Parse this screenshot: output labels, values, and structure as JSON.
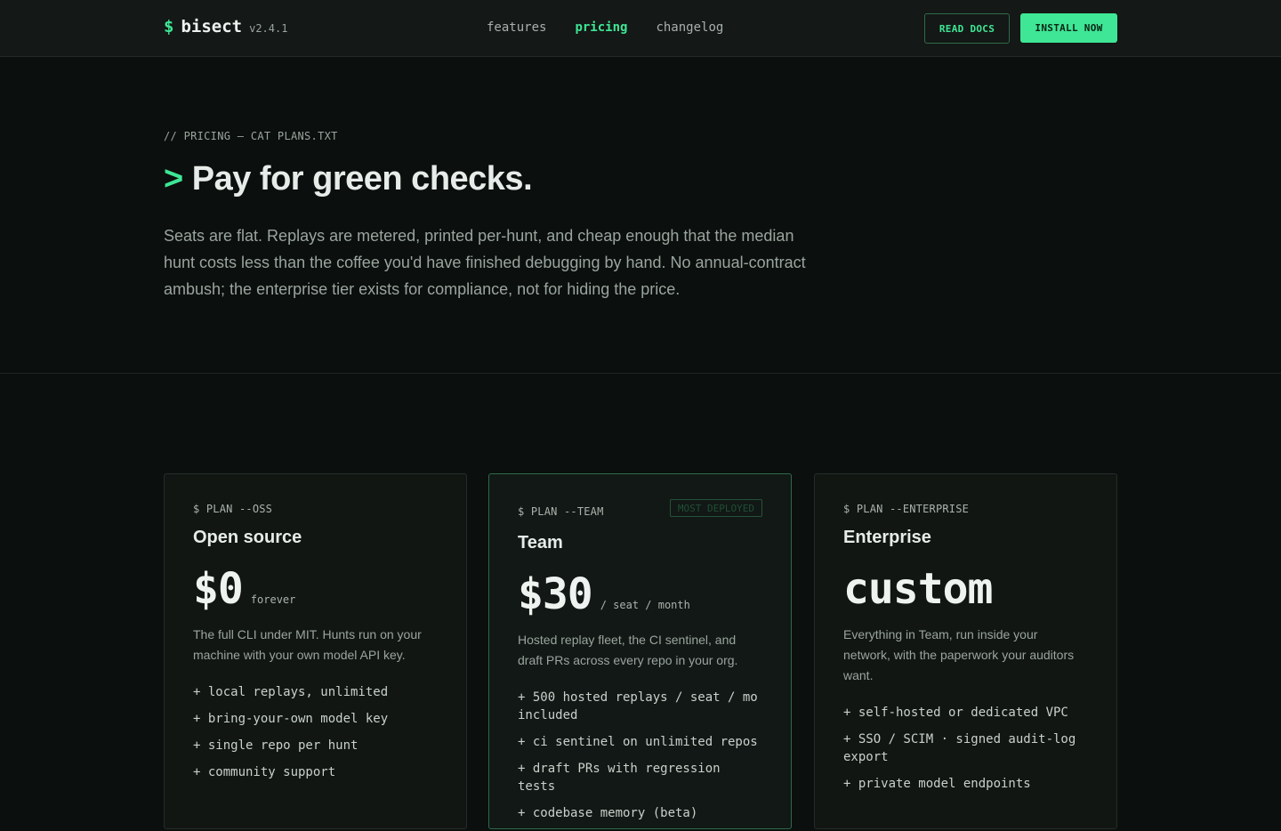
{
  "header": {
    "brand_symbol": "$",
    "brand_name": "bisect",
    "version": "v2.4.1",
    "nav": [
      {
        "label": "features",
        "active": false
      },
      {
        "label": "pricing",
        "active": true
      },
      {
        "label": "changelog",
        "active": false
      }
    ],
    "read_docs_label": "READ DOCS",
    "install_label": "INSTALL NOW"
  },
  "hero": {
    "crumb": "// PRICING — CAT PLANS.TXT",
    "prompt": ">",
    "headline": "Pay for green checks.",
    "lede": "Seats are flat. Replays are metered, printed per-hunt, and cheap enough that the median hunt costs less than the coffee you'd have finished debugging by hand. No annual-contract ambush; the enterprise tier exists for compliance, not for hiding the price."
  },
  "plans": [
    {
      "cmd": "$ PLAN --OSS",
      "name": "Open source",
      "price": "$0",
      "unit": "forever",
      "description": "The full CLI under MIT. Hunts run on your machine with your own model API key.",
      "features": [
        "+ local replays, unlimited",
        "+ bring-your-own model key",
        "+ single repo per hunt",
        "+ community support"
      ]
    },
    {
      "cmd": "$ PLAN --TEAM",
      "badge": "MOST DEPLOYED",
      "name": "Team",
      "price": "$30",
      "unit": "/ seat / month",
      "description": "Hosted replay fleet, the CI sentinel, and draft PRs across every repo in your org.",
      "features": [
        "+ 500 hosted replays / seat / mo included",
        "+ ci sentinel on unlimited repos",
        "+ draft PRs with regression tests",
        "+ codebase memory (beta)"
      ]
    },
    {
      "cmd": "$ PLAN --ENTERPRISE",
      "name": "Enterprise",
      "price": "custom",
      "unit": "",
      "description": "Everything in Team, run inside your network, with the paperwork your auditors want.",
      "features": [
        "+ self-hosted or dedicated VPC",
        "+ SSO / SCIM · signed audit-log export",
        "+ private model endpoints"
      ]
    }
  ],
  "colors": {
    "accent": "#3ee695",
    "background": "#0b0f0d",
    "header_bg": "#141816",
    "muted_text": "#9aa59e"
  }
}
